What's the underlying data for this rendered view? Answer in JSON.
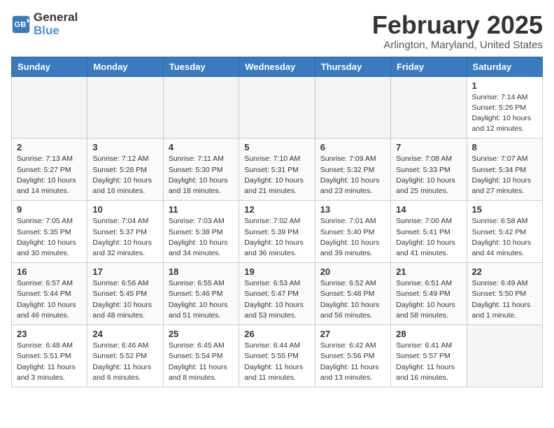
{
  "header": {
    "logo_line1": "General",
    "logo_line2": "Blue",
    "month": "February 2025",
    "location": "Arlington, Maryland, United States"
  },
  "days_of_week": [
    "Sunday",
    "Monday",
    "Tuesday",
    "Wednesday",
    "Thursday",
    "Friday",
    "Saturday"
  ],
  "weeks": [
    [
      {
        "day": null
      },
      {
        "day": null
      },
      {
        "day": null
      },
      {
        "day": null
      },
      {
        "day": null
      },
      {
        "day": null
      },
      {
        "day": "1",
        "info": "Sunrise: 7:14 AM\nSunset: 5:26 PM\nDaylight: 10 hours\nand 12 minutes."
      }
    ],
    [
      {
        "day": "2",
        "info": "Sunrise: 7:13 AM\nSunset: 5:27 PM\nDaylight: 10 hours\nand 14 minutes."
      },
      {
        "day": "3",
        "info": "Sunrise: 7:12 AM\nSunset: 5:28 PM\nDaylight: 10 hours\nand 16 minutes."
      },
      {
        "day": "4",
        "info": "Sunrise: 7:11 AM\nSunset: 5:30 PM\nDaylight: 10 hours\nand 18 minutes."
      },
      {
        "day": "5",
        "info": "Sunrise: 7:10 AM\nSunset: 5:31 PM\nDaylight: 10 hours\nand 21 minutes."
      },
      {
        "day": "6",
        "info": "Sunrise: 7:09 AM\nSunset: 5:32 PM\nDaylight: 10 hours\nand 23 minutes."
      },
      {
        "day": "7",
        "info": "Sunrise: 7:08 AM\nSunset: 5:33 PM\nDaylight: 10 hours\nand 25 minutes."
      },
      {
        "day": "8",
        "info": "Sunrise: 7:07 AM\nSunset: 5:34 PM\nDaylight: 10 hours\nand 27 minutes."
      }
    ],
    [
      {
        "day": "9",
        "info": "Sunrise: 7:05 AM\nSunset: 5:35 PM\nDaylight: 10 hours\nand 30 minutes."
      },
      {
        "day": "10",
        "info": "Sunrise: 7:04 AM\nSunset: 5:37 PM\nDaylight: 10 hours\nand 32 minutes."
      },
      {
        "day": "11",
        "info": "Sunrise: 7:03 AM\nSunset: 5:38 PM\nDaylight: 10 hours\nand 34 minutes."
      },
      {
        "day": "12",
        "info": "Sunrise: 7:02 AM\nSunset: 5:39 PM\nDaylight: 10 hours\nand 36 minutes."
      },
      {
        "day": "13",
        "info": "Sunrise: 7:01 AM\nSunset: 5:40 PM\nDaylight: 10 hours\nand 39 minutes."
      },
      {
        "day": "14",
        "info": "Sunrise: 7:00 AM\nSunset: 5:41 PM\nDaylight: 10 hours\nand 41 minutes."
      },
      {
        "day": "15",
        "info": "Sunrise: 6:58 AM\nSunset: 5:42 PM\nDaylight: 10 hours\nand 44 minutes."
      }
    ],
    [
      {
        "day": "16",
        "info": "Sunrise: 6:57 AM\nSunset: 5:44 PM\nDaylight: 10 hours\nand 46 minutes."
      },
      {
        "day": "17",
        "info": "Sunrise: 6:56 AM\nSunset: 5:45 PM\nDaylight: 10 hours\nand 48 minutes."
      },
      {
        "day": "18",
        "info": "Sunrise: 6:55 AM\nSunset: 5:46 PM\nDaylight: 10 hours\nand 51 minutes."
      },
      {
        "day": "19",
        "info": "Sunrise: 6:53 AM\nSunset: 5:47 PM\nDaylight: 10 hours\nand 53 minutes."
      },
      {
        "day": "20",
        "info": "Sunrise: 6:52 AM\nSunset: 5:48 PM\nDaylight: 10 hours\nand 56 minutes."
      },
      {
        "day": "21",
        "info": "Sunrise: 6:51 AM\nSunset: 5:49 PM\nDaylight: 10 hours\nand 58 minutes."
      },
      {
        "day": "22",
        "info": "Sunrise: 6:49 AM\nSunset: 5:50 PM\nDaylight: 11 hours\nand 1 minute."
      }
    ],
    [
      {
        "day": "23",
        "info": "Sunrise: 6:48 AM\nSunset: 5:51 PM\nDaylight: 11 hours\nand 3 minutes."
      },
      {
        "day": "24",
        "info": "Sunrise: 6:46 AM\nSunset: 5:52 PM\nDaylight: 11 hours\nand 6 minutes."
      },
      {
        "day": "25",
        "info": "Sunrise: 6:45 AM\nSunset: 5:54 PM\nDaylight: 11 hours\nand 8 minutes."
      },
      {
        "day": "26",
        "info": "Sunrise: 6:44 AM\nSunset: 5:55 PM\nDaylight: 11 hours\nand 11 minutes."
      },
      {
        "day": "27",
        "info": "Sunrise: 6:42 AM\nSunset: 5:56 PM\nDaylight: 11 hours\nand 13 minutes."
      },
      {
        "day": "28",
        "info": "Sunrise: 6:41 AM\nSunset: 5:57 PM\nDaylight: 11 hours\nand 16 minutes."
      },
      {
        "day": null
      }
    ]
  ]
}
